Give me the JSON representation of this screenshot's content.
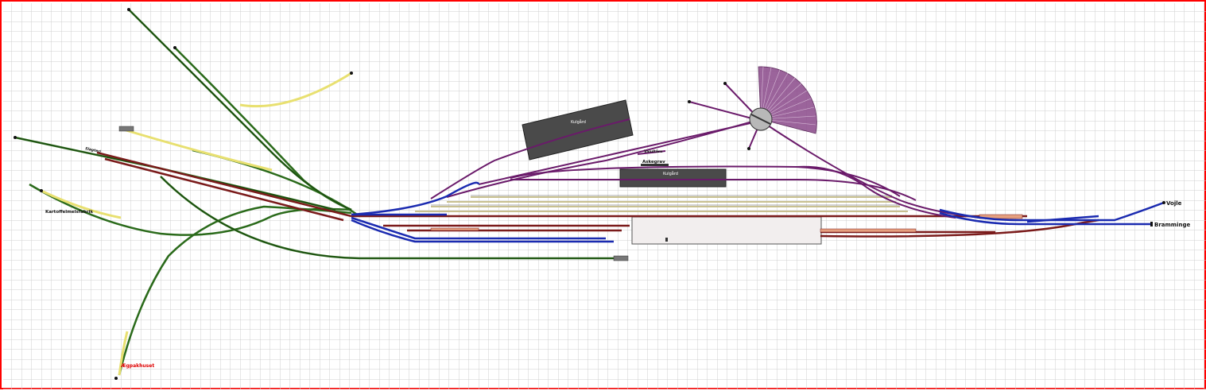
{
  "diagram": {
    "background": "#ffffff",
    "grid_color": "#cfcfcf",
    "frame_color": "#ff0000",
    "colors": {
      "green_track": "#2a6a1a",
      "yellow_track": "#e8e070",
      "purple_track": "#6a1a6a",
      "blue_track": "#1a2ab0",
      "brown_track": "#7a1a1a",
      "olive_track": "#c8c090",
      "building_dark": "#4a4a4a",
      "platform": "#f2eeee",
      "turntable": "#b8b8b8"
    }
  },
  "labels": {
    "vojle": "Vojle",
    "bramminge": "Bramminge",
    "kulgard_upper": "Kulgård",
    "kulgard_lower": "Kulgård",
    "askegrav": "Askegrav",
    "kartoffelmelsfabrik": "Kartoffelmelsfabrik",
    "egpakhuset": "Ægpakhuset",
    "small_upper_left": "Slagteri",
    "small_mid": "Vandtårn"
  }
}
